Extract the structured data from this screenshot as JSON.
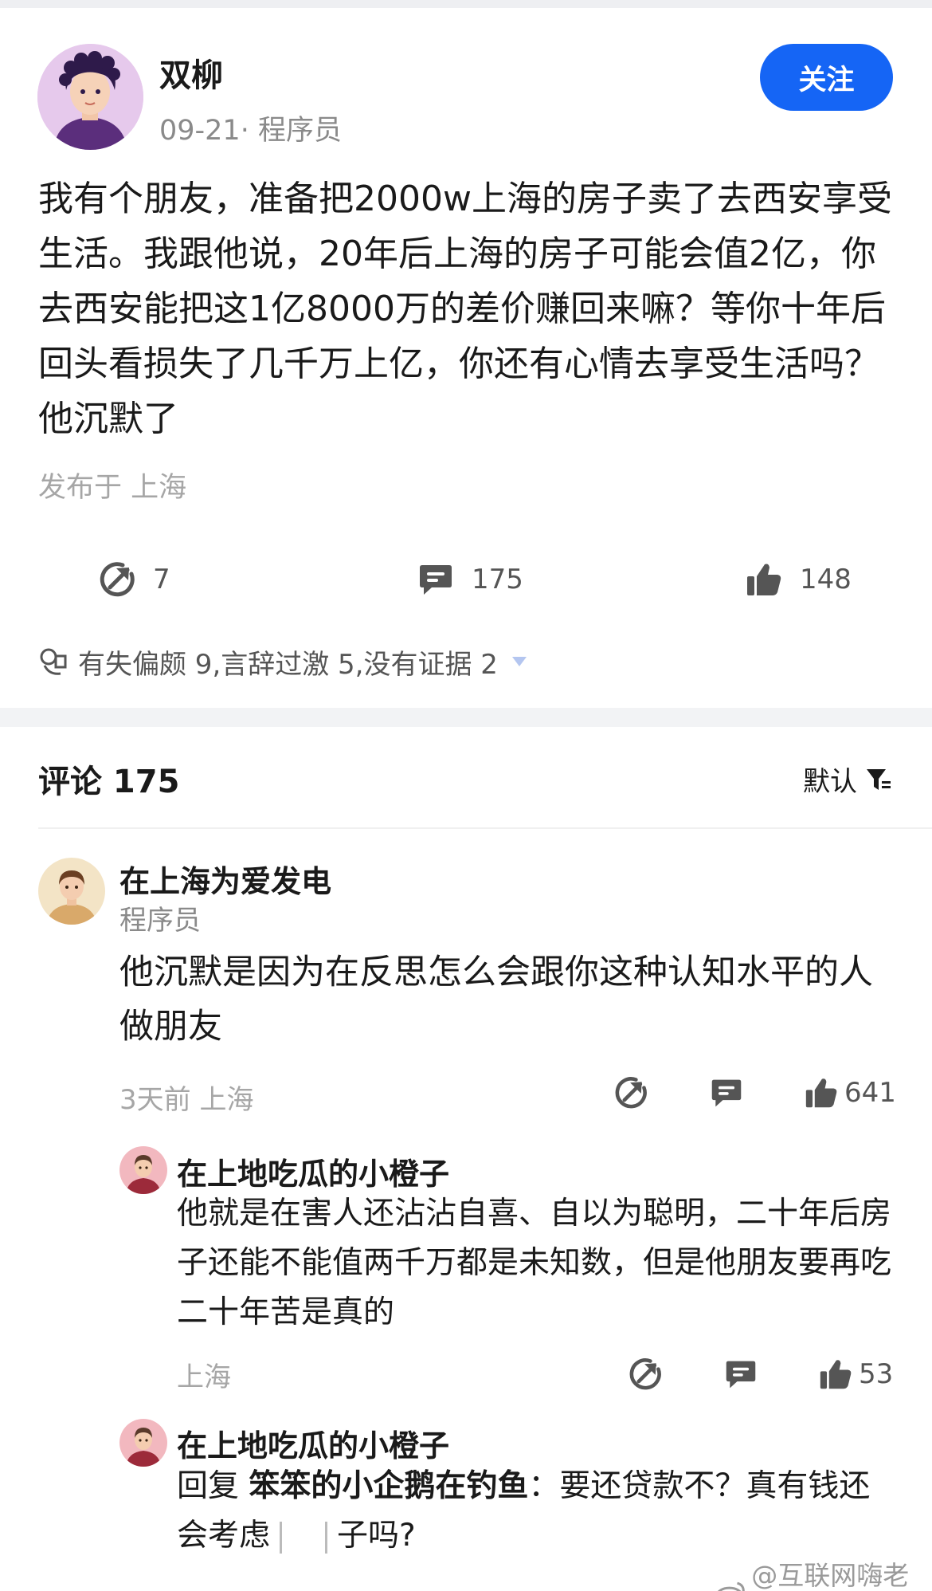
{
  "post": {
    "author": "双柳",
    "meta": "09-21· 程序员",
    "follow_label": "关注",
    "body": "我有个朋友，准备把2000w上海的房子卖了去西安享受生活。我跟他说，20年后上海的房子可能会值2亿，你去西安能把这1亿8000万的差价赚回来嘛？等你十年后回头看损失了几千万上亿，你还有心情去享受生活吗？他沉默了",
    "location": "发布于 上海",
    "forward_count": "7",
    "comment_count": "175",
    "like_count": "148",
    "rating_text": "有失偏颇 9,言辞过激 5,没有证据 2"
  },
  "comments_header": {
    "title": "评论 175",
    "sort_label": "默认"
  },
  "comments": [
    {
      "name": "在上海为爱发电",
      "sub": "程序员",
      "text": "他沉默是因为在反思怎么会跟你这种认知水平的人做朋友",
      "meta": "3天前  上海",
      "likes": "641"
    }
  ],
  "replies": [
    {
      "name": "在上地吃瓜的小橙子",
      "text": "他就是在害人还沾沾自喜、自以为聪明，二十年后房子还能不能值两千万都是未知数，但是他朋友要再吃二十年苦是真的",
      "meta": "上海",
      "likes": "53"
    },
    {
      "name": "在上地吃瓜的小橙子",
      "reply_prefix": "回复 ",
      "reply_target": "笨笨的小企鹅在钓鱼",
      "text_a": "：要还贷款不？真有钱还会考虑",
      "text_b": "子吗?"
    }
  ],
  "watermark": "@互联网嗨老板",
  "colors": {
    "accent": "#1565f5",
    "muted": "#a6a6a6",
    "band": "#f2f3f5"
  }
}
